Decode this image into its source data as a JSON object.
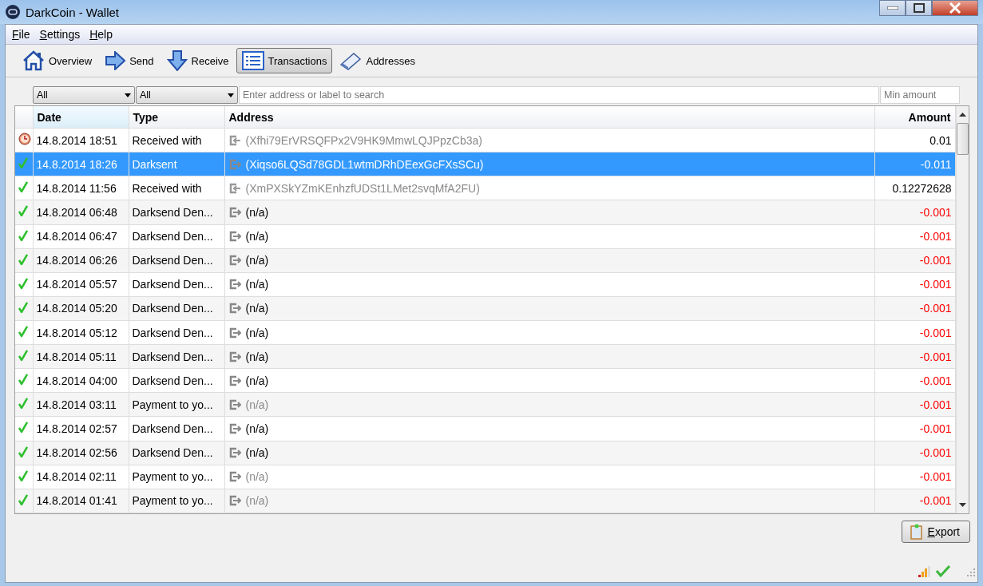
{
  "window": {
    "title": "DarkCoin - Wallet"
  },
  "menu": [
    "File",
    "Settings",
    "Help"
  ],
  "toolbar": [
    {
      "label": "Overview",
      "kind": "home",
      "selected": false
    },
    {
      "label": "Send",
      "kind": "send",
      "selected": false
    },
    {
      "label": "Receive",
      "kind": "receive",
      "selected": false
    },
    {
      "label": "Transactions",
      "kind": "list",
      "selected": true
    },
    {
      "label": "Addresses",
      "kind": "book",
      "selected": false
    }
  ],
  "filters": {
    "date": "All",
    "type": "All",
    "search": {
      "placeholder": "Enter address or label to search"
    },
    "min_amount": {
      "placeholder": "Min amount"
    }
  },
  "table": {
    "columns": [
      "Date",
      "Type",
      "Address",
      "Amount"
    ],
    "rows": [
      {
        "pending": true,
        "date": "14.8.2014 18:51",
        "type": "Received with",
        "incoming": true,
        "address": "(Xfhi79ErVRSQFPx2V9HK9MmwLQJPpzCb3a)",
        "address_dimmed": true,
        "amount": "0.01",
        "negative": false,
        "selected": false
      },
      {
        "pending": false,
        "date": "14.8.2014 18:26",
        "type": "Darksent",
        "incoming": false,
        "address": "(Xiqso6LQSd78GDL1wtmDRhDEexGcFXsSCu)",
        "address_dimmed": true,
        "amount": "-0.011",
        "negative": true,
        "selected": true
      },
      {
        "pending": false,
        "date": "14.8.2014 11:56",
        "type": "Received with",
        "incoming": true,
        "address": "(XmPXSkYZmKEnhzfUDSt1LMet2svqMfA2FU)",
        "address_dimmed": true,
        "amount": "0.12272628",
        "negative": false,
        "selected": false
      },
      {
        "pending": false,
        "date": "14.8.2014 06:48",
        "type": "Darksend Den...",
        "incoming": false,
        "address": "(n/a)",
        "address_dimmed": false,
        "amount": "-0.001",
        "negative": true,
        "selected": false
      },
      {
        "pending": false,
        "date": "14.8.2014 06:47",
        "type": "Darksend Den...",
        "incoming": false,
        "address": "(n/a)",
        "address_dimmed": false,
        "amount": "-0.001",
        "negative": true,
        "selected": false
      },
      {
        "pending": false,
        "date": "14.8.2014 06:26",
        "type": "Darksend Den...",
        "incoming": false,
        "address": "(n/a)",
        "address_dimmed": false,
        "amount": "-0.001",
        "negative": true,
        "selected": false
      },
      {
        "pending": false,
        "date": "14.8.2014 05:57",
        "type": "Darksend Den...",
        "incoming": false,
        "address": "(n/a)",
        "address_dimmed": false,
        "amount": "-0.001",
        "negative": true,
        "selected": false
      },
      {
        "pending": false,
        "date": "14.8.2014 05:20",
        "type": "Darksend Den...",
        "incoming": false,
        "address": "(n/a)",
        "address_dimmed": false,
        "amount": "-0.001",
        "negative": true,
        "selected": false
      },
      {
        "pending": false,
        "date": "14.8.2014 05:12",
        "type": "Darksend Den...",
        "incoming": false,
        "address": "(n/a)",
        "address_dimmed": false,
        "amount": "-0.001",
        "negative": true,
        "selected": false
      },
      {
        "pending": false,
        "date": "14.8.2014 05:11",
        "type": "Darksend Den...",
        "incoming": false,
        "address": "(n/a)",
        "address_dimmed": false,
        "amount": "-0.001",
        "negative": true,
        "selected": false
      },
      {
        "pending": false,
        "date": "14.8.2014 04:00",
        "type": "Darksend Den...",
        "incoming": false,
        "address": "(n/a)",
        "address_dimmed": false,
        "amount": "-0.001",
        "negative": true,
        "selected": false
      },
      {
        "pending": false,
        "date": "14.8.2014 03:11",
        "type": "Payment to yo...",
        "incoming": false,
        "address": "(n/a)",
        "address_dimmed": true,
        "amount": "-0.001",
        "negative": true,
        "selected": false
      },
      {
        "pending": false,
        "date": "14.8.2014 02:57",
        "type": "Darksend Den...",
        "incoming": false,
        "address": "(n/a)",
        "address_dimmed": false,
        "amount": "-0.001",
        "negative": true,
        "selected": false
      },
      {
        "pending": false,
        "date": "14.8.2014 02:56",
        "type": "Darksend Den...",
        "incoming": false,
        "address": "(n/a)",
        "address_dimmed": false,
        "amount": "-0.001",
        "negative": true,
        "selected": false
      },
      {
        "pending": false,
        "date": "14.8.2014 02:11",
        "type": "Payment to yo...",
        "incoming": false,
        "address": "(n/a)",
        "address_dimmed": true,
        "amount": "-0.001",
        "negative": true,
        "selected": false
      },
      {
        "pending": false,
        "date": "14.8.2014 01:41",
        "type": "Payment to yo...",
        "incoming": false,
        "address": "(n/a)",
        "address_dimmed": true,
        "amount": "-0.001",
        "negative": true,
        "selected": false
      }
    ]
  },
  "export_button": "Export"
}
